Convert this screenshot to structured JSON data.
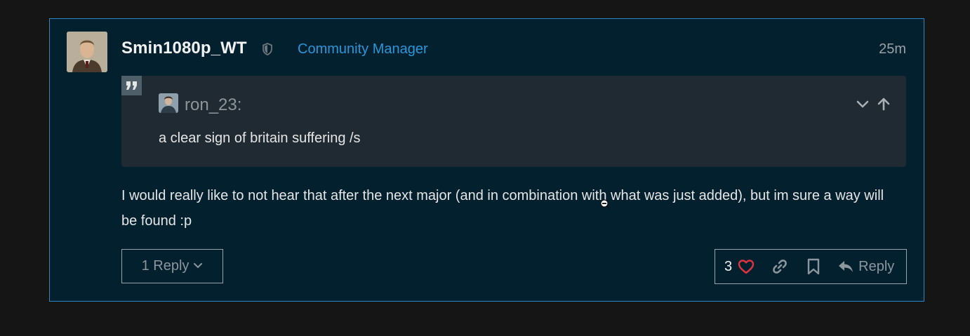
{
  "post": {
    "username": "Smin1080p_WT",
    "role": "Community Manager",
    "time": "25m",
    "quote": {
      "user": "ron_23:",
      "text": "a clear sign of britain suffering /s"
    },
    "body": "I would really like to not hear that after the next major (and in combination with what was just added), but im sure a way will be found :p",
    "replies_label": "1 Reply",
    "likes": "3",
    "reply_label": "Reply"
  },
  "colors": {
    "post_bg": "#03202f",
    "post_border": "#2f86bd",
    "role": "#2a96d8",
    "heart": "#e0343f",
    "quote_bg": "#1f2a32"
  },
  "icons": [
    "shield-icon",
    "quote-icon",
    "chevron-down-icon",
    "arrow-up-icon",
    "heart-icon",
    "link-icon",
    "bookmark-icon",
    "reply-icon"
  ]
}
